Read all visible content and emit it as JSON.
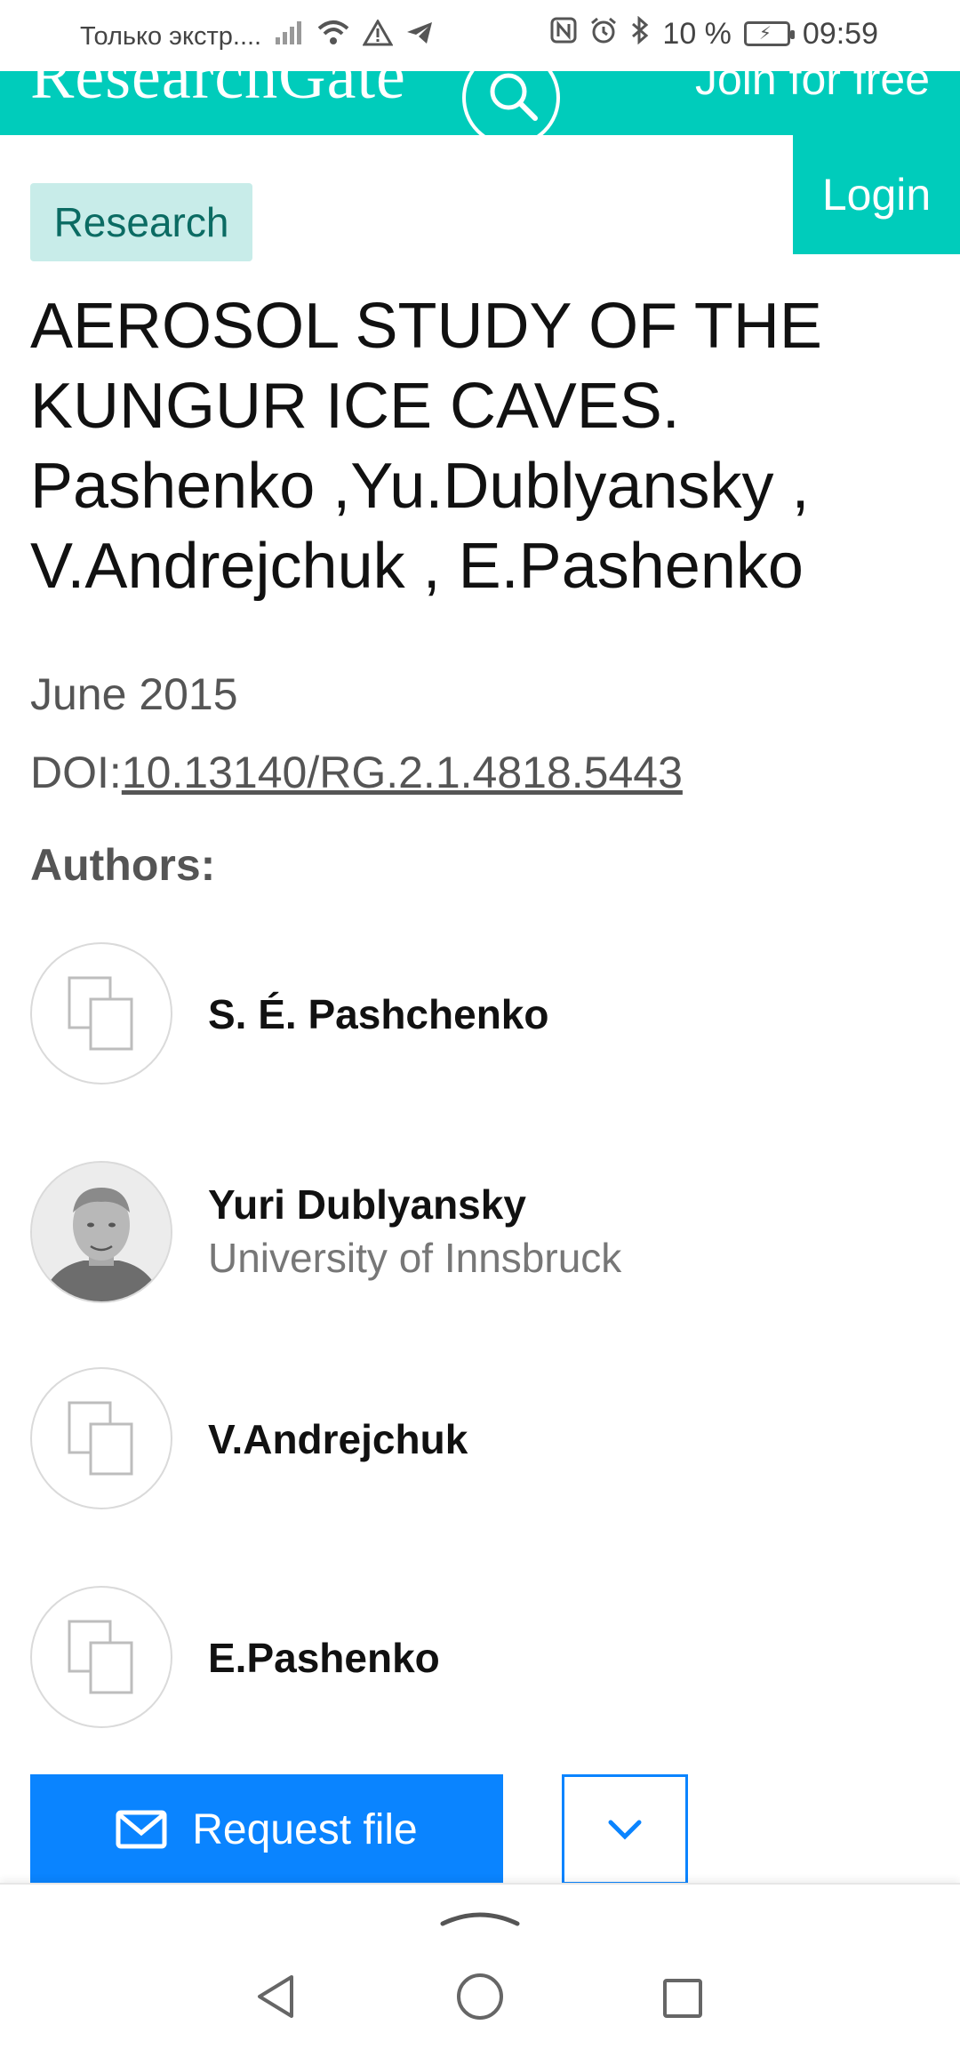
{
  "status_bar": {
    "carrier": "Только экстр....",
    "battery": "10 %",
    "time": "09:59"
  },
  "header": {
    "logo": "ResearchGate",
    "join": "Join for free",
    "login": "Login"
  },
  "article": {
    "badge": "Research",
    "title": "AEROSOL STUDY OF THE KUNGUR ICE CAVES. Pashenko ,Yu.Dublyansky , V.Andrejchuk , E.Pashenko",
    "date": "June 2015",
    "doi_label": "DOI:",
    "doi_value": "10.13140/RG.2.1.4818.5443"
  },
  "authors": {
    "heading": "Authors:",
    "items": [
      {
        "name": "S. É. Pashchenko",
        "affiliation": ""
      },
      {
        "name": "Yuri Dublyansky",
        "affiliation": "University of Innsbruck"
      },
      {
        "name": "V.Andrejchuk",
        "affiliation": ""
      },
      {
        "name": "E.Pashenko",
        "affiliation": ""
      }
    ]
  },
  "actions": {
    "request_file": "Request file"
  },
  "colors": {
    "brand": "#00ccbb",
    "primary": "#0a84ff",
    "badge_bg": "#c8ece9"
  }
}
